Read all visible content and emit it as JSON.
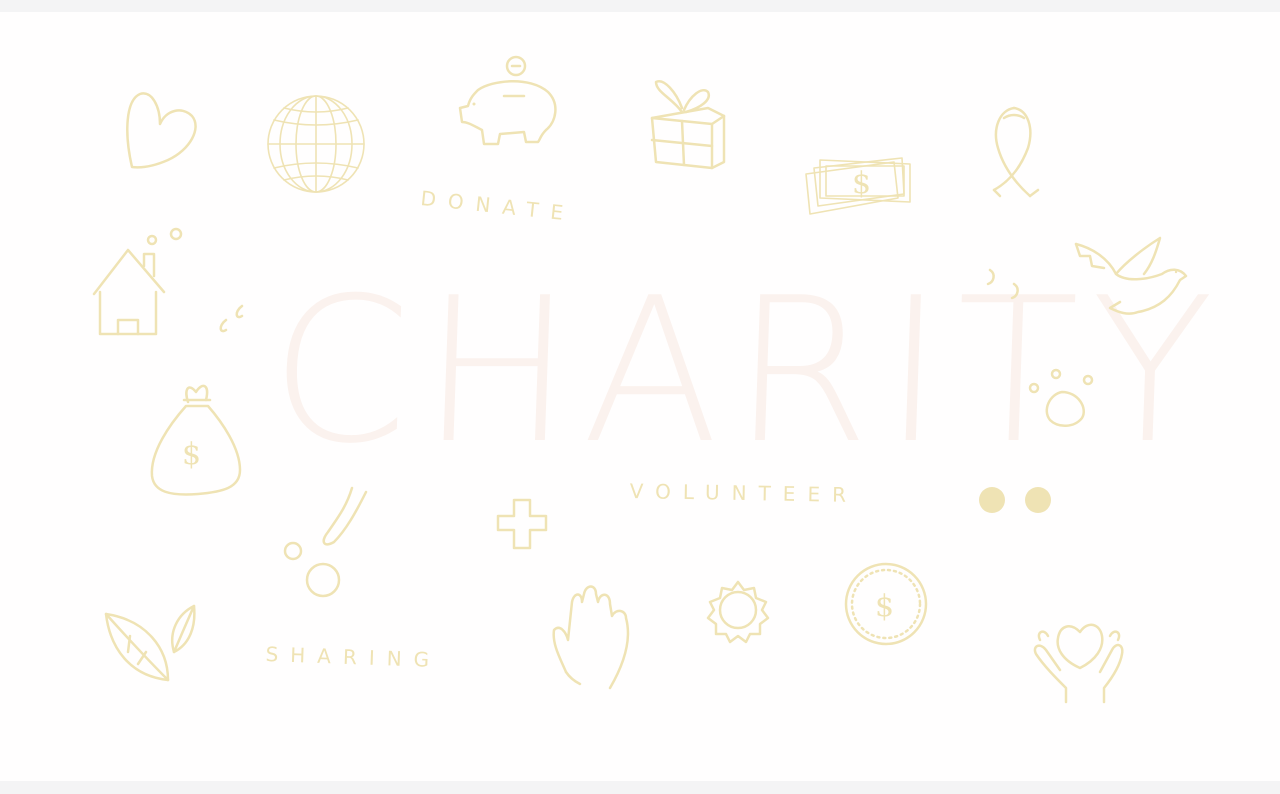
{
  "colors": {
    "accent": "#efe3b4",
    "title": "#fbf2ee",
    "background": "#fffefe"
  },
  "illustration": {
    "title": "CHARITY",
    "words": {
      "donate": "DONATE",
      "volunteer": "VOLUNTEER",
      "sharing": "SHARING"
    },
    "icons": [
      "heart-icon",
      "globe-icon",
      "piggy-bank-icon",
      "gift-box-icon",
      "banknotes-icon",
      "awareness-ribbon-icon",
      "house-icon",
      "dove-icon",
      "money-bag-icon",
      "paw-print-icon",
      "plus-icon",
      "leaves-icon",
      "raised-hand-icon",
      "sun-icon",
      "dollar-coin-icon",
      "hands-heart-icon"
    ]
  }
}
